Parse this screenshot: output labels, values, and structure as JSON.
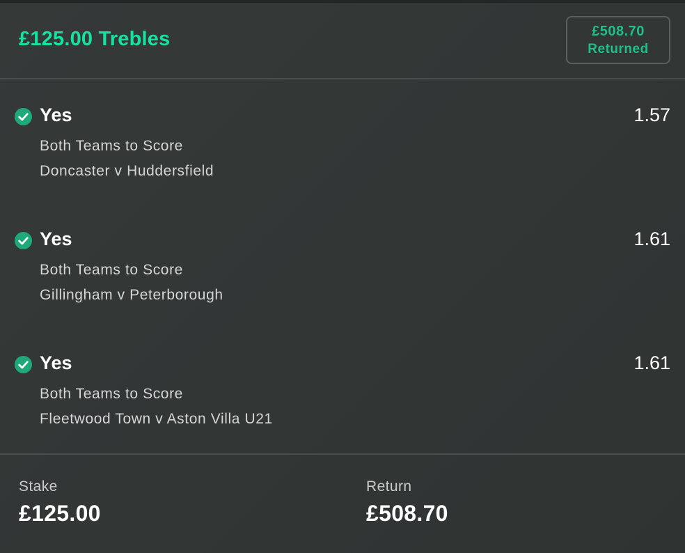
{
  "bet": {
    "title": "£125.00 Trebles",
    "returned_amount": "£508.70",
    "returned_label": "Returned"
  },
  "selections": [
    {
      "name": "Yes",
      "odds": "1.57",
      "market": "Both Teams to Score",
      "event": "Doncaster v Huddersfield",
      "status_icon": "check-circle-icon"
    },
    {
      "name": "Yes",
      "odds": "1.61",
      "market": "Both Teams to Score",
      "event": "Gillingham v Peterborough",
      "status_icon": "check-circle-icon"
    },
    {
      "name": "Yes",
      "odds": "1.61",
      "market": "Both Teams to Score",
      "event": "Fleetwood Town v Aston Villa U21",
      "status_icon": "check-circle-icon"
    }
  ],
  "summary": {
    "stake_label": "Stake",
    "stake_value": "£125.00",
    "return_label": "Return",
    "return_value": "£508.70"
  },
  "colors": {
    "accent": "#16e2a0",
    "check": "#1fa87a",
    "background": "#343837"
  }
}
